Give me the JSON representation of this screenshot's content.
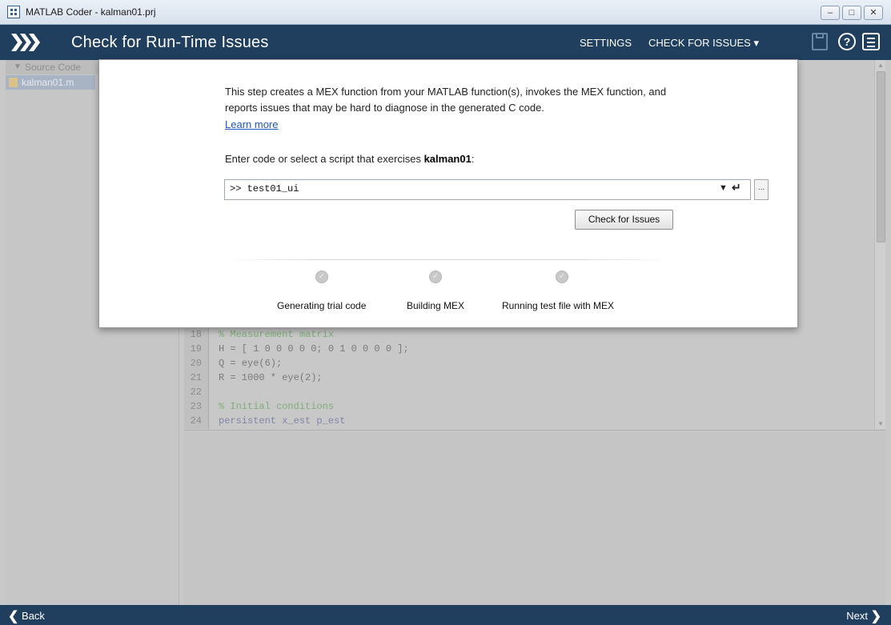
{
  "window": {
    "title": "MATLAB Coder - kalman01.prj",
    "controls": {
      "minimize": "–",
      "restore": "□",
      "close": "✕"
    }
  },
  "header": {
    "page_title": "Check for Run-Time Issues",
    "settings_label": "SETTINGS",
    "check_issues_label": "CHECK FOR ISSUES ▾",
    "help_glyph": "?"
  },
  "sidebar": {
    "section_label": "Source Code",
    "files": [
      {
        "name": "kalman01.m",
        "selected": true
      }
    ]
  },
  "editor": {
    "lines": [
      {
        "num": "18",
        "text": "% Measurement matrix",
        "kind": "comment"
      },
      {
        "num": "19",
        "text": "H = [ 1 0 0 0 0 0; 0 1 0 0 0 0 ];",
        "kind": "code"
      },
      {
        "num": "20",
        "text": "Q = eye(6);",
        "kind": "code"
      },
      {
        "num": "21",
        "text": "R = 1000 * eye(2);",
        "kind": "code"
      },
      {
        "num": "22",
        "text": "",
        "kind": "code"
      },
      {
        "num": "23",
        "text": "% Initial conditions",
        "kind": "comment"
      },
      {
        "num": "24",
        "text": "persistent x_est p_est",
        "kind": "keyword"
      }
    ]
  },
  "dialog": {
    "description": "This step creates a MEX function from your MATLAB function(s), invokes the MEX function, and reports issues that may be hard to diagnose in the generated C code.",
    "learn_more": "Learn more",
    "prompt_prefix": "Enter code or select a script that exercises ",
    "function_name": "kalman01",
    "prompt_suffix": ":",
    "input_value": ">> test01_ui",
    "dropdown_glyph": "▼",
    "enter_glyph": "↵",
    "browse_label": "...",
    "check_button": "Check for Issues",
    "steps": [
      {
        "label": "Generating trial code",
        "status": "pending"
      },
      {
        "label": "Building MEX",
        "status": "pending"
      },
      {
        "label": "Running test file with MEX",
        "status": "pending"
      }
    ],
    "step_glyph": "✓"
  },
  "footer": {
    "back_label": "Back",
    "next_label": "Next"
  },
  "colors": {
    "header_bg": "#203e5d",
    "link": "#1f57b8",
    "comment": "#7fae7a"
  }
}
